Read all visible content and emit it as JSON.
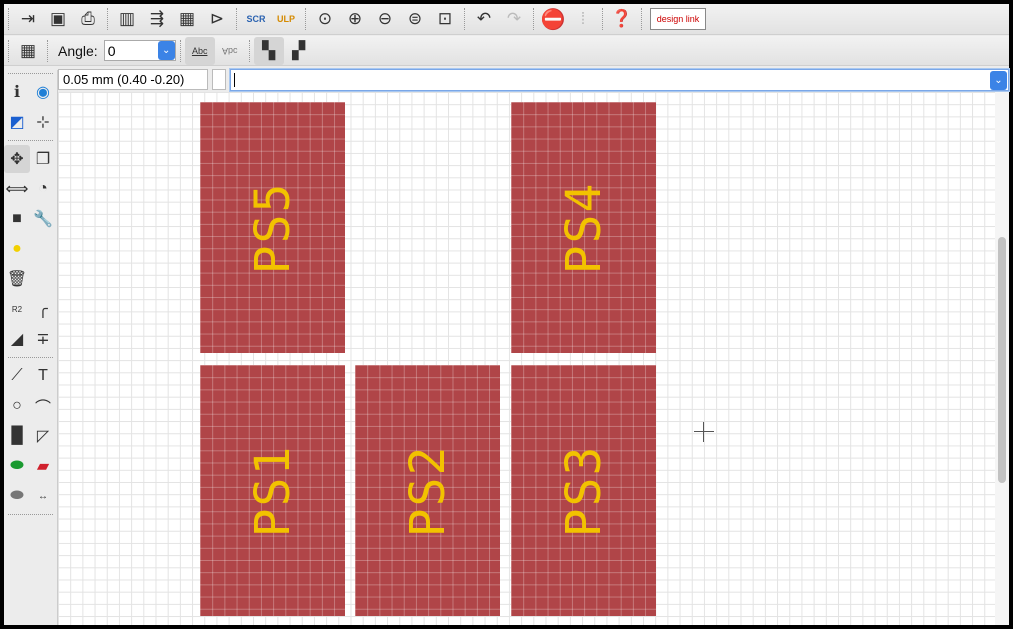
{
  "toolbar1": {
    "icons": [
      "open-icon",
      "save-icon",
      "print-icon",
      "library-icon",
      "board-schematic-switch-icon",
      "use-icon",
      "cam-icon",
      "script-icon",
      "ulp-icon",
      "zoom-fit-icon",
      "zoom-in-icon",
      "zoom-out-icon",
      "zoom-redraw-icon",
      "zoom-select-icon",
      "undo-icon",
      "redo-icon",
      "stop-icon",
      "go-icon",
      "help-icon"
    ],
    "script_label": "SCR",
    "ulp_label": "ULP",
    "designlink_label": "design link"
  },
  "toolbar2": {
    "angle_label": "Angle:",
    "angle_value": "0",
    "text_normal": "Abc",
    "text_mirrored": "Abc"
  },
  "command": {
    "grid_coord": "0.05 mm (0.40 -0.20)",
    "input_value": ""
  },
  "left_tools": [
    "info",
    "show",
    "display-layers",
    "mark",
    "move",
    "copy",
    "mirror",
    "rotate",
    "group",
    "change",
    "paste-via",
    "delete",
    "name-value",
    "miter",
    "split",
    "optimize",
    "wire",
    "text",
    "circle",
    "arc",
    "rectangle",
    "polygon",
    "via",
    "smd",
    "pad",
    "dimension"
  ],
  "pads": [
    {
      "name": "PS5"
    },
    {
      "name": "PS4"
    },
    {
      "name": "PS1"
    },
    {
      "name": "PS2"
    },
    {
      "name": "PS3"
    }
  ],
  "colors": {
    "pad": "#b04548",
    "label": "#f2c200",
    "accent": "#3b83e6"
  }
}
